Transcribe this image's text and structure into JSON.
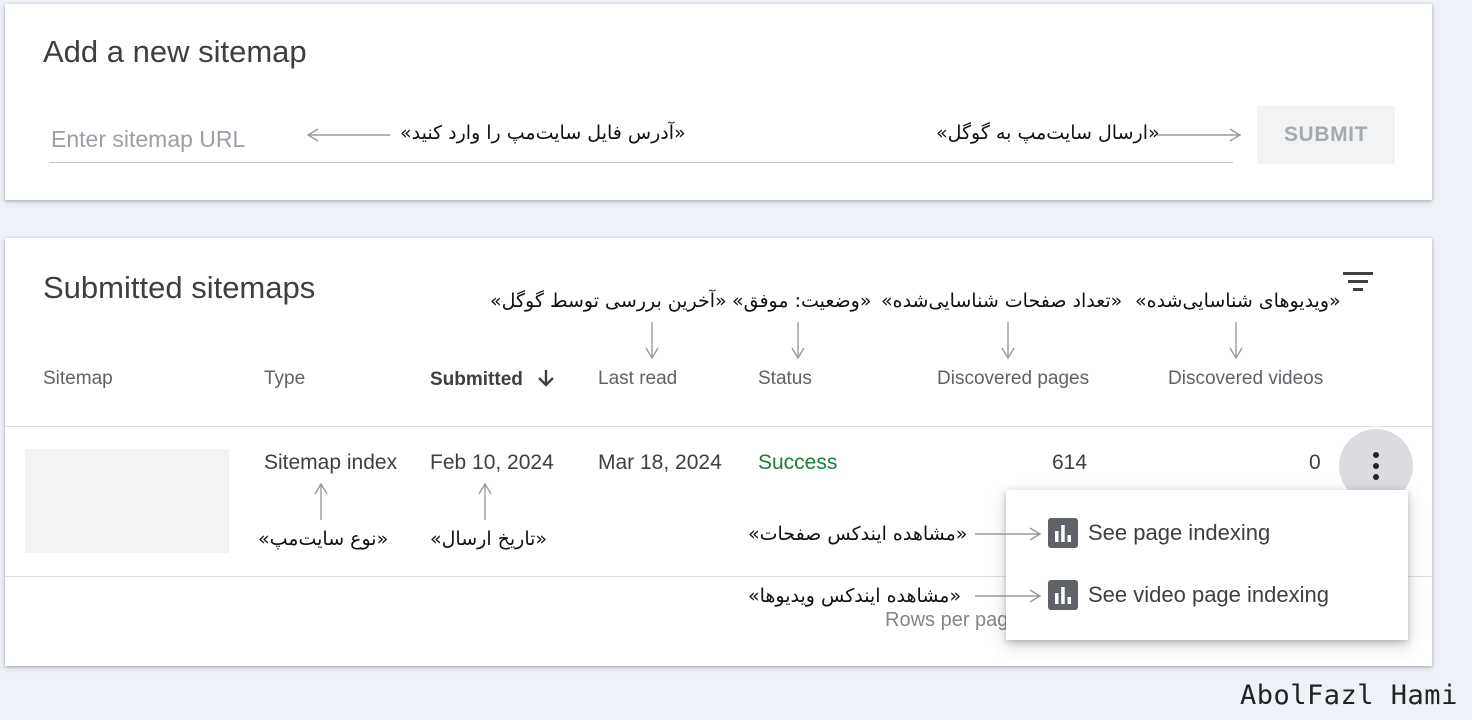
{
  "add_card": {
    "title": "Add a new sitemap",
    "input_placeholder": "Enter sitemap URL",
    "submit_label": "SUBMIT",
    "annotation_input": "«آدرس فایل سایت‌مپ را وارد کنید»",
    "annotation_submit": "«ارسال سایت‌مپ به گوگل»"
  },
  "submitted_card": {
    "title": "Submitted sitemaps",
    "filter_icon": "filter-icon",
    "columns": {
      "sitemap": "Sitemap",
      "type": "Type",
      "submitted": "Submitted",
      "last_read": "Last read",
      "status": "Status",
      "discovered_pages": "Discovered pages",
      "discovered_videos": "Discovered videos"
    },
    "sort_icon": "arrow-down-icon",
    "header_annotations": {
      "last_read": "«آخرین بررسی توسط گوگل»",
      "status": "«وضعیت: موفق»",
      "pages": "«تعداد صفحات شناسایی‌شده»",
      "videos": "«ویدیوهای شناسایی‌شده»"
    },
    "row": {
      "type": "Sitemap index",
      "submitted": "Feb 10, 2024",
      "last_read": "Mar 18, 2024",
      "status": "Success",
      "discovered_pages": "614",
      "discovered_videos": "0"
    },
    "row_annotations": {
      "type": "«نوع سایت‌مپ»",
      "submitted": "«تاریخ ارسال»"
    },
    "footer_text": "Rows per page",
    "status_color": "#188038"
  },
  "menu": {
    "items": [
      {
        "label": "See page indexing",
        "icon": "bar-chart-icon",
        "annotation": "«مشاهده ایندکس صفحات»"
      },
      {
        "label": "See video page indexing",
        "icon": "bar-chart-icon",
        "annotation": "«مشاهده ایندکس ویدیوها»"
      }
    ]
  },
  "watermark": "AbolFazl Hami"
}
